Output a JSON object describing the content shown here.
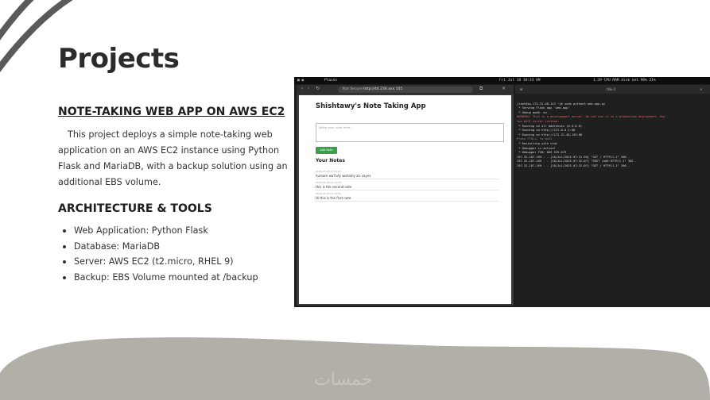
{
  "slide": {
    "title": "Projects",
    "section1_heading": "NOTE-TAKING WEB APP ON AWS EC2",
    "section1_paragraph": "This project deploys a simple note-taking web application on an AWS EC2 instance using Python Flask and MariaDB, with a backup solution using an additional EBS volume.",
    "section2_heading": "ARCHITECTURE & TOOLS",
    "bullets": [
      "Web Application: Python Flask",
      "Database: MariaDB",
      "Server: AWS EC2 (t2.micro, RHEL 9)",
      "Backup: EBS Volume mounted at /backup"
    ],
    "watermark": "خمسات"
  },
  "screenshot": {
    "topbar": {
      "app": "Places",
      "datetime": "Fri Jul 18  10:33 AM",
      "status": "1.39  CPU  RAM  disk  net  98%  21%"
    },
    "browser": {
      "security": "Not Secure",
      "url": "http://44.236.xxx.105",
      "page_title": "Shishtawy's Note Taking App",
      "textarea_placeholder": "Write your note here...",
      "add_button": "Add Note",
      "notes_heading": "Your Notes",
      "notes": [
        {
          "timestamp": "2025-07-18 07:32:07",
          "text": "humam wa7sdy wehalny zis xayes"
        },
        {
          "timestamp": "2025-07-18 07:31:59",
          "text": "this is the second note"
        },
        {
          "timestamp": "2025-07-18 07:31:50",
          "text": "Hi this is the first note"
        }
      ]
    },
    "terminal": {
      "title": "tilix-1",
      "lines": [
        "[root@ip-172-31-48-143 ~]# sudo python3 web-app.py",
        " * Serving Flask app 'web-app'",
        " * Debug mode: on",
        "WARNING: This is a development server. Do not use it in a production deployment. Use",
        "ion WSGI server instead.",
        " * Running on all addresses (0.0.0.0)",
        " * Running on http://127.0.0.1:80",
        " * Running on http://172.31.48.143:80",
        "Press CTRL+C to quit",
        " * Restarting with stat",
        " * Debugger is active!",
        " * Debugger PIN: 809-529-879",
        "197.32.107.109 - - [18/Jul/2025 07:31:50] \"GET / HTTP/1.1\" 200 -",
        "197.32.107.109 - - [18/Jul/2025 07:32:07] \"POST /add HTTP/1.1\" 302 -",
        "197.32.107.109 - - [18/Jul/2025 07:32:07] \"GET / HTTP/1.1\" 200 -"
      ]
    }
  }
}
